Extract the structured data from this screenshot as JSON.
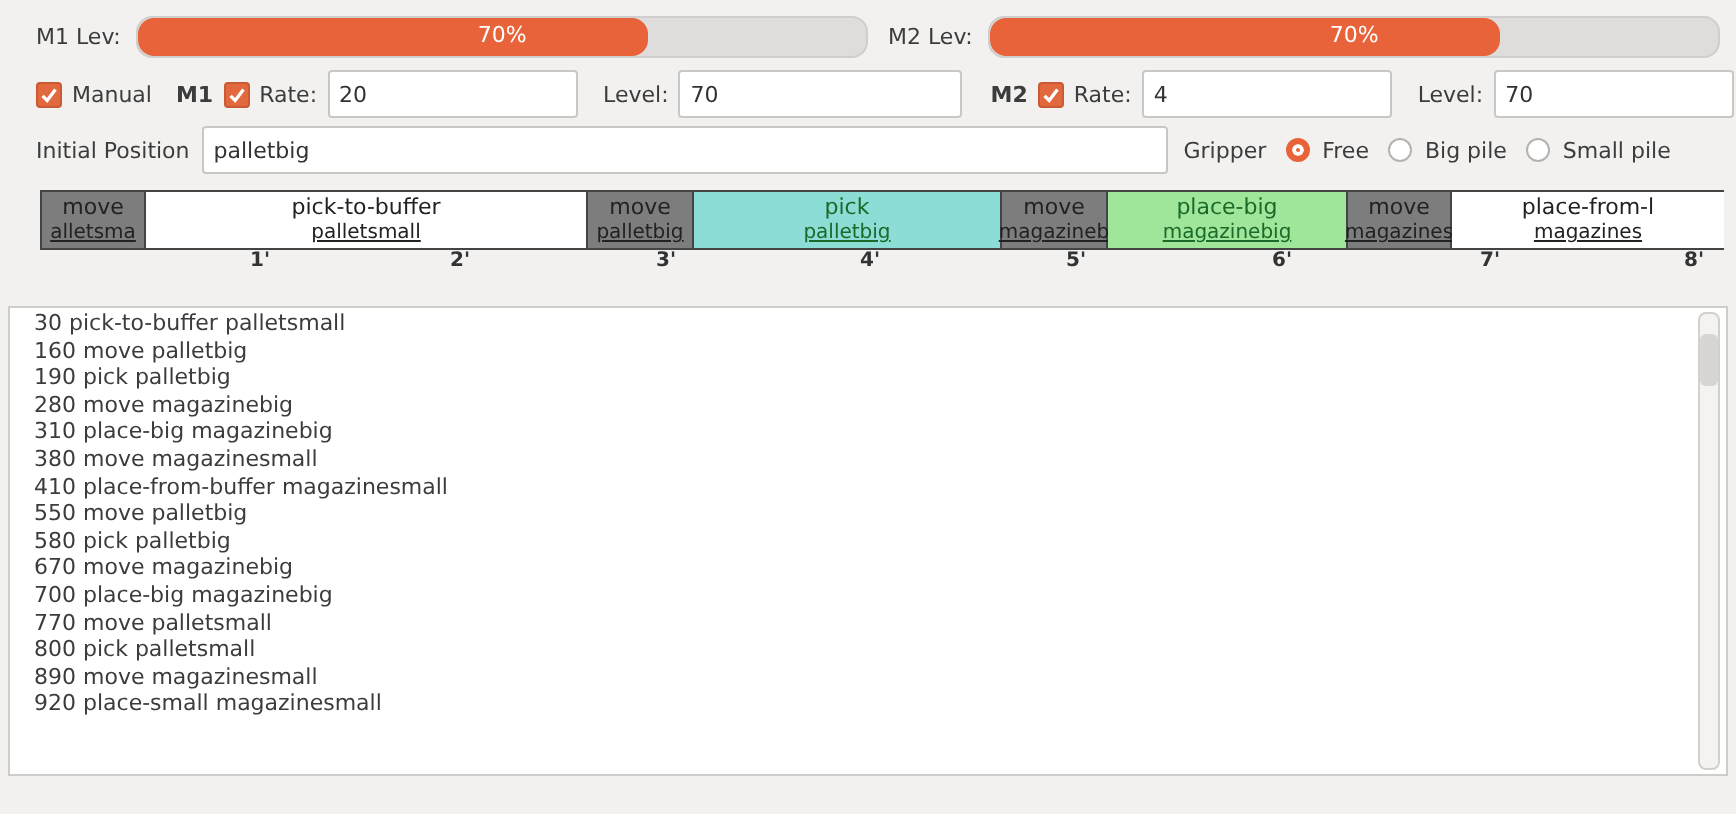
{
  "meters": [
    {
      "label": "M1 Lev:",
      "level": 0.7,
      "reading": "70%"
    },
    {
      "label": "M2 Lev:",
      "level": 0.7,
      "reading": "70%"
    }
  ],
  "manual": {
    "label": "Manual",
    "checked": true
  },
  "machines": [
    {
      "name": "M1",
      "rate_checked": true,
      "rate_label": "Rate:",
      "rate": "20",
      "level_label": "Level:",
      "level_value": "70"
    },
    {
      "name": "M2",
      "rate_checked": true,
      "rate_label": "Rate:",
      "rate": "4",
      "level_label": "Level:",
      "level_value": "70"
    }
  ],
  "initial_position": {
    "label": "Initial Position",
    "value": "palletbig"
  },
  "gripper": {
    "label": "Gripper",
    "options": [
      {
        "label": "Free",
        "selected": true
      },
      {
        "label": "Big pile",
        "selected": false
      },
      {
        "label": "Small pile",
        "selected": false
      }
    ]
  },
  "timeline": {
    "blocks": [
      {
        "action": "move",
        "target": "alletsma",
        "color": "#7d7d7d"
      },
      {
        "action": "pick-to-buffer",
        "target": "palletsmall",
        "color": "#ffffff"
      },
      {
        "action": "move",
        "target": "palletbig",
        "color": "#7d7d7d"
      },
      {
        "action": "pick",
        "target": "palletbig",
        "color": "#8cddd5"
      },
      {
        "action": "move",
        "target": "magazineb",
        "color": "#7d7d7d"
      },
      {
        "action": "place-big",
        "target": "magazinebig",
        "color": "#9fe69b"
      },
      {
        "action": "move",
        "target": "magazines",
        "color": "#7d7d7d"
      },
      {
        "action": "place-from-l",
        "target": "magazines",
        "color": "#ffffff"
      }
    ],
    "ticks": [
      "1'",
      "2'",
      "3'",
      "4'",
      "5'",
      "6'",
      "7'",
      "8'"
    ]
  },
  "log": [
    "30 pick-to-buffer palletsmall",
    "160 move palletbig",
    "190 pick palletbig",
    "280 move magazinebig",
    "310 place-big magazinebig",
    "380 move magazinesmall",
    "410 place-from-buffer magazinesmall",
    "550 move palletbig",
    "580 pick palletbig",
    "670 move magazinebig",
    "700 place-big magazinebig",
    "770 move palletsmall",
    "800 pick palletsmall",
    "890 move magazinesmall",
    "920 place-small magazinesmall"
  ]
}
